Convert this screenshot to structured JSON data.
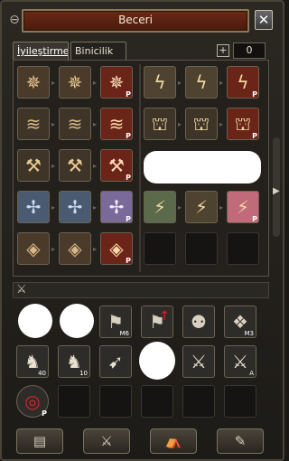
{
  "window": {
    "title": "Beceri",
    "close_symbol": "✕",
    "pin_symbol": "⊖"
  },
  "tabs": {
    "items": [
      "İyileştirme",
      "Binicilik"
    ],
    "active_index": 0
  },
  "points": {
    "plus_symbol": "+",
    "value": "0"
  },
  "skills_left": [
    {
      "glyph": "✵",
      "tag": ""
    },
    {
      "glyph": "✵",
      "tag": ""
    },
    {
      "glyph": "✵",
      "tag": "P"
    },
    {
      "glyph": "≋",
      "tag": ""
    },
    {
      "glyph": "≋",
      "tag": ""
    },
    {
      "glyph": "≋",
      "tag": "P"
    },
    {
      "glyph": "⚒",
      "tag": ""
    },
    {
      "glyph": "⚒",
      "tag": ""
    },
    {
      "glyph": "⚒",
      "tag": "P"
    },
    {
      "glyph": "✢",
      "tag": ""
    },
    {
      "glyph": "✢",
      "tag": ""
    },
    {
      "glyph": "✢",
      "tag": "P"
    },
    {
      "glyph": "◈",
      "tag": ""
    },
    {
      "glyph": "◈",
      "tag": ""
    },
    {
      "glyph": "◈",
      "tag": "P"
    }
  ],
  "skills_right": [
    {
      "glyph": "ϟ",
      "tag": ""
    },
    {
      "glyph": "ϟ",
      "tag": ""
    },
    {
      "glyph": "ϟ",
      "tag": "P"
    },
    {
      "glyph": "⛫",
      "tag": ""
    },
    {
      "glyph": "⛫",
      "tag": ""
    },
    {
      "glyph": "⛫",
      "tag": "P"
    },
    {
      "glyph": "⚡",
      "tag": ""
    },
    {
      "glyph": "⚡",
      "tag": ""
    },
    {
      "glyph": "⚡",
      "tag": "P"
    }
  ],
  "bottom_skills": {
    "row1": [
      {
        "glyph": "",
        "tag": ""
      },
      {
        "glyph": "",
        "tag": ""
      },
      {
        "glyph": "⚑",
        "tag": "M6"
      },
      {
        "glyph": "⚑",
        "tag": ""
      },
      {
        "glyph": "⚉",
        "tag": ""
      },
      {
        "glyph": "❖",
        "tag": "M3"
      }
    ],
    "row2": [
      {
        "glyph": "♞",
        "tag": "40"
      },
      {
        "glyph": "♞",
        "tag": "10"
      },
      {
        "glyph": "➹",
        "tag": ""
      },
      {
        "glyph": "",
        "tag": ""
      },
      {
        "glyph": "⚔",
        "tag": ""
      },
      {
        "glyph": "⚔",
        "tag": "A"
      }
    ],
    "row3": [
      {
        "glyph": "◎",
        "tag": "P"
      }
    ]
  },
  "footer": {
    "buttons": [
      "▤",
      "⚔",
      "⛺",
      "✎"
    ]
  },
  "colors": {
    "accent_red": "#6a2a14",
    "border": "#8a7a5a"
  }
}
